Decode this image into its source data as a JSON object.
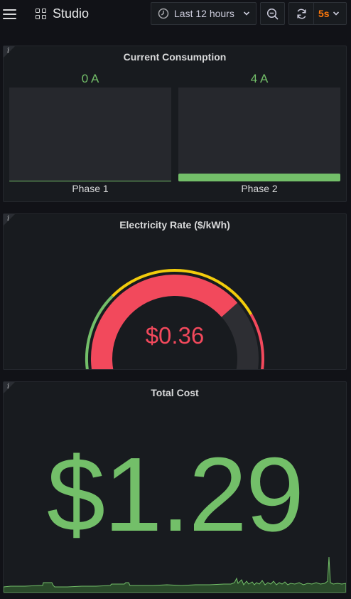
{
  "header": {
    "dashboard_title": "Studio",
    "time_range": "Last 12 hours",
    "refresh_interval": "5s"
  },
  "panels": {
    "current": {
      "title": "Current Consumption",
      "phases": [
        {
          "value": "0 A",
          "label": "Phase 1",
          "fill_fraction": 0.0
        },
        {
          "value": "4 A",
          "label": "Phase 2",
          "fill_fraction": 0.08
        }
      ]
    },
    "rate": {
      "title": "Electricity Rate ($/kWh)",
      "value": "$0.36",
      "fill_fraction": 0.72
    },
    "cost": {
      "title": "Total Cost",
      "value": "$1.29"
    }
  },
  "colors": {
    "green": "#73bf69",
    "red": "#f2495c",
    "yellow": "#f2cc0c",
    "orange": "#ff780a"
  }
}
